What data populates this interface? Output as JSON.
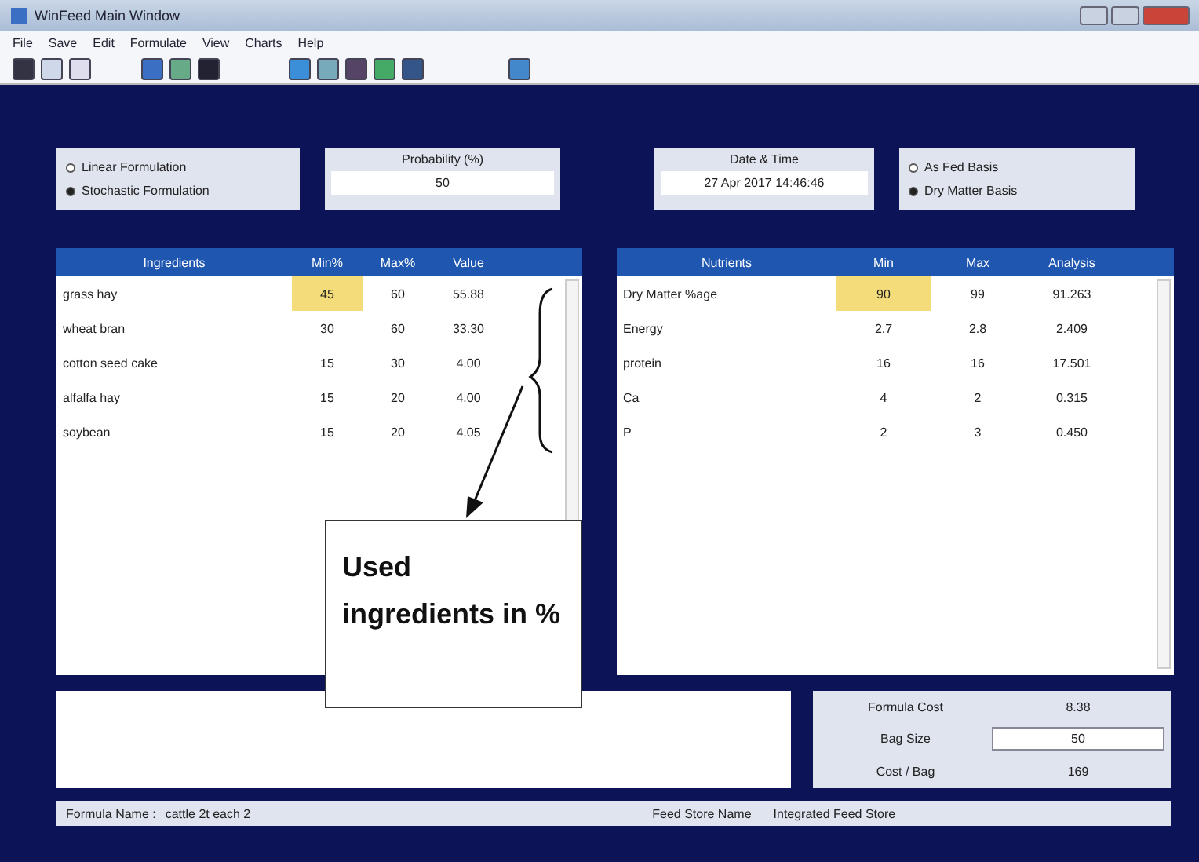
{
  "window": {
    "title": "WinFeed Main Window"
  },
  "menu": [
    "File",
    "Save",
    "Edit",
    "Formulate",
    "View",
    "Charts",
    "Help"
  ],
  "formulation": [
    {
      "label": "Linear Formulation",
      "selected": false
    },
    {
      "label": "Stochastic Formulation",
      "selected": true
    }
  ],
  "probability": {
    "label": "Probability (%)",
    "value": "50"
  },
  "date_time": {
    "label": "Date & Time",
    "value": "27 Apr 2017 14:46:46"
  },
  "basis": [
    {
      "label": "As Fed Basis",
      "selected": false
    },
    {
      "label": "Dry Matter Basis",
      "selected": true
    }
  ],
  "ingredients": {
    "columns": [
      "Ingredients",
      "Min%",
      "Max%",
      "Value"
    ],
    "rows": [
      {
        "cells": [
          "grass hay",
          "45",
          "60",
          "55.88"
        ],
        "highlighted": true
      },
      {
        "cells": [
          "wheat bran",
          "30",
          "60",
          "33.30"
        ],
        "highlighted": false
      },
      {
        "cells": [
          "cotton seed cake",
          "15",
          "30",
          "4.00"
        ],
        "highlighted": false
      },
      {
        "cells": [
          "alfalfa hay",
          "15",
          "20",
          "4.00"
        ],
        "highlighted": false
      },
      {
        "cells": [
          "soybean",
          "15",
          "20",
          "4.05"
        ],
        "highlighted": false
      }
    ]
  },
  "nutrients": {
    "columns": [
      "Nutrients",
      "Min",
      "Max",
      "Analysis"
    ],
    "rows": [
      {
        "cells": [
          "Dry Matter %age",
          "90",
          "99",
          "91.263"
        ],
        "highlighted": true
      },
      {
        "cells": [
          "Energy",
          "2.7",
          "2.8",
          "2.409"
        ],
        "highlighted": false
      },
      {
        "cells": [
          "protein",
          "16",
          "16",
          "17.501"
        ],
        "highlighted": false
      },
      {
        "cells": [
          "Ca",
          "4",
          "2",
          "0.315"
        ],
        "highlighted": false
      },
      {
        "cells": [
          "P",
          "2",
          "3",
          "0.450"
        ],
        "highlighted": false
      }
    ]
  },
  "callout": {
    "text": "Used ingredients in %"
  },
  "costs": [
    {
      "label": "Formula Cost",
      "value": "8.38",
      "boxed": false
    },
    {
      "label": "Bag Size",
      "value": "50",
      "boxed": true
    },
    {
      "label": "Cost / Bag",
      "value": "169",
      "boxed": false
    }
  ],
  "status_bar": {
    "formula_label": "Formula Name :",
    "formula_value": "cattle 2t each 2",
    "store_label": "Feed Store Name",
    "store_value": "Integrated Feed Store"
  }
}
